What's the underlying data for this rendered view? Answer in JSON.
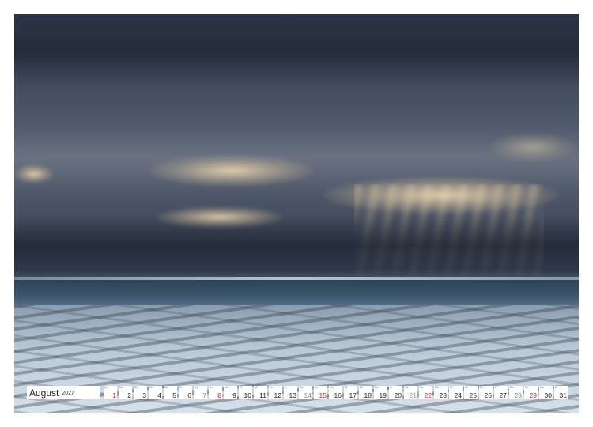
{
  "calendar": {
    "month": "August",
    "year": "2027",
    "days": [
      {
        "n": "1",
        "wd": "So",
        "kind": "sun"
      },
      {
        "n": "2",
        "wd": "Mo",
        "kind": "week"
      },
      {
        "n": "3",
        "wd": "Di",
        "kind": "week"
      },
      {
        "n": "4",
        "wd": "Mi",
        "kind": "week"
      },
      {
        "n": "5",
        "wd": "Do",
        "kind": "week"
      },
      {
        "n": "6",
        "wd": "Fr",
        "kind": "week"
      },
      {
        "n": "7",
        "wd": "Sa",
        "kind": "sat"
      },
      {
        "n": "8",
        "wd": "So",
        "kind": "sun"
      },
      {
        "n": "9",
        "wd": "Mo",
        "kind": "week"
      },
      {
        "n": "10",
        "wd": "Di",
        "kind": "week"
      },
      {
        "n": "11",
        "wd": "Mi",
        "kind": "week"
      },
      {
        "n": "12",
        "wd": "Do",
        "kind": "week"
      },
      {
        "n": "13",
        "wd": "Fr",
        "kind": "week"
      },
      {
        "n": "14",
        "wd": "Sa",
        "kind": "sat"
      },
      {
        "n": "15",
        "wd": "So",
        "kind": "sun"
      },
      {
        "n": "16",
        "wd": "Mo",
        "kind": "week"
      },
      {
        "n": "17",
        "wd": "Di",
        "kind": "week"
      },
      {
        "n": "18",
        "wd": "Mi",
        "kind": "week"
      },
      {
        "n": "19",
        "wd": "Do",
        "kind": "week"
      },
      {
        "n": "20",
        "wd": "Fr",
        "kind": "week"
      },
      {
        "n": "21",
        "wd": "Sa",
        "kind": "sat"
      },
      {
        "n": "22",
        "wd": "So",
        "kind": "sun"
      },
      {
        "n": "23",
        "wd": "Mo",
        "kind": "week"
      },
      {
        "n": "24",
        "wd": "Di",
        "kind": "week"
      },
      {
        "n": "25",
        "wd": "Mi",
        "kind": "week"
      },
      {
        "n": "26",
        "wd": "Do",
        "kind": "week"
      },
      {
        "n": "27",
        "wd": "Fr",
        "kind": "week"
      },
      {
        "n": "28",
        "wd": "Sa",
        "kind": "sat"
      },
      {
        "n": "29",
        "wd": "So",
        "kind": "sun"
      },
      {
        "n": "30",
        "wd": "Mo",
        "kind": "week"
      },
      {
        "n": "31",
        "wd": "Di",
        "kind": "week"
      }
    ]
  },
  "colors": {
    "sunday": "#c2262d",
    "saturday": "#8a8a8a",
    "weekday": "#222222"
  }
}
